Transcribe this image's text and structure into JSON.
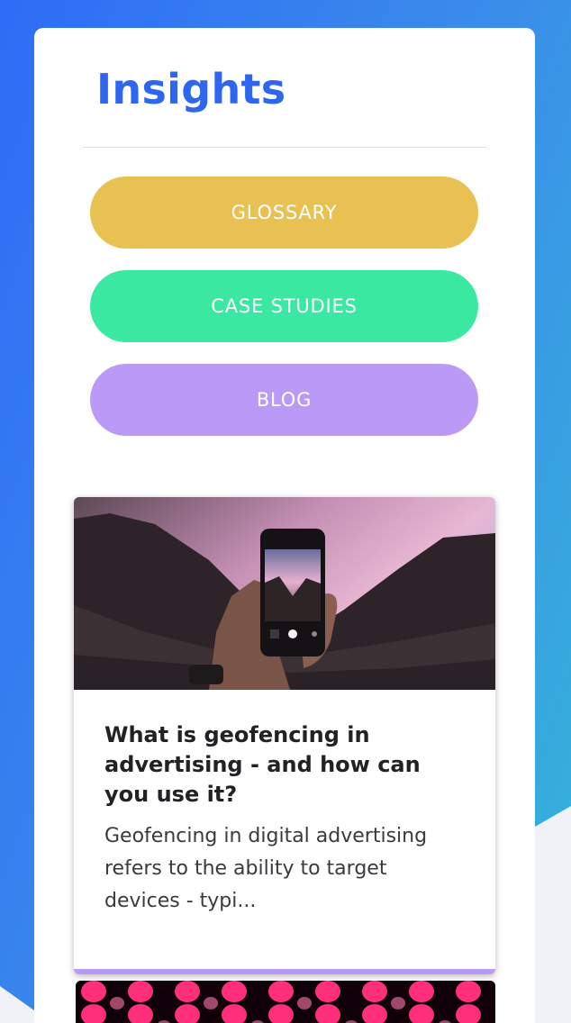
{
  "page": {
    "title": "Insights"
  },
  "nav": {
    "items": [
      {
        "label": "GLOSSARY",
        "color": "#e9c052"
      },
      {
        "label": "CASE STUDIES",
        "color": "#3be8a2"
      },
      {
        "label": "BLOG",
        "color": "#bb9af7"
      }
    ]
  },
  "posts": [
    {
      "image_icon": "smartphone-photo-mountains",
      "title": "What is geofencing in advertising - and how can you use it?",
      "excerpt": "Geofencing in digital advertising refers to the ability to target devices - typi..."
    },
    {
      "image_icon": "pink-bokeh-lights"
    }
  ],
  "colors": {
    "accent": "#2f66f0",
    "card_accent": "#b89af2"
  }
}
